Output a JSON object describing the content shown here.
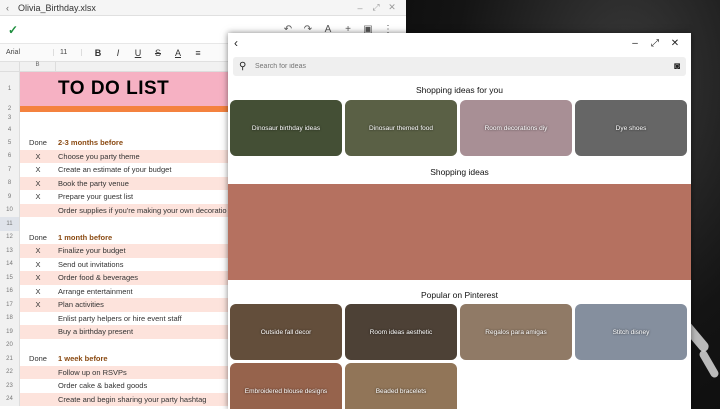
{
  "sheet": {
    "filename": "Olivia_Birthday.xlsx",
    "font": "Arial",
    "font_size": "11",
    "col_headers": [
      "B",
      "C"
    ],
    "rows": [
      {
        "n": "1",
        "a": "",
        "b": "TO DO LIST",
        "style": "title-row"
      },
      {
        "n": "2",
        "a": "",
        "b": "",
        "style": "orange"
      },
      {
        "n": "3",
        "a": "",
        "b": "",
        "style": "blank"
      },
      {
        "n": "4",
        "a": "",
        "b": "",
        "style": "blank"
      },
      {
        "n": "5",
        "a": "Done",
        "b": "2-3 months before",
        "style": "r hdr"
      },
      {
        "n": "6",
        "a": "X",
        "b": "Choose you party theme",
        "style": "r pink"
      },
      {
        "n": "7",
        "a": "X",
        "b": "Create an estimate of your budget",
        "style": "r"
      },
      {
        "n": "8",
        "a": "X",
        "b": "Book the party venue",
        "style": "r pink"
      },
      {
        "n": "9",
        "a": "X",
        "b": "Prepare your guest list",
        "style": "r"
      },
      {
        "n": "10",
        "a": "",
        "b": "Order supplies if you're making your own decoratio",
        "style": "r pink"
      },
      {
        "n": "11",
        "a": "",
        "b": "",
        "style": "r gray"
      },
      {
        "n": "12",
        "a": "Done",
        "b": "1 month before",
        "style": "r hdr"
      },
      {
        "n": "13",
        "a": "X",
        "b": "Finalize your budget",
        "style": "r pink"
      },
      {
        "n": "14",
        "a": "X",
        "b": "Send out invitations",
        "style": "r"
      },
      {
        "n": "15",
        "a": "X",
        "b": "Order food & beverages",
        "style": "r pink"
      },
      {
        "n": "16",
        "a": "X",
        "b": "Arrange entertainment",
        "style": "r"
      },
      {
        "n": "17",
        "a": "X",
        "b": "Plan activities",
        "style": "r pink"
      },
      {
        "n": "18",
        "a": "",
        "b": "Enlist party helpers or hire event staff",
        "style": "r"
      },
      {
        "n": "19",
        "a": "",
        "b": "Buy a birthday present",
        "style": "r pink"
      },
      {
        "n": "20",
        "a": "",
        "b": "",
        "style": "r"
      },
      {
        "n": "21",
        "a": "Done",
        "b": "1 week before",
        "style": "r hdr"
      },
      {
        "n": "22",
        "a": "",
        "b": "Follow up on RSVPs",
        "style": "r pink"
      },
      {
        "n": "23",
        "a": "",
        "b": "Order cake & baked goods",
        "style": "r"
      },
      {
        "n": "24",
        "a": "",
        "b": "Create and begin sharing your party hashtag",
        "style": "r pink"
      }
    ]
  },
  "pinterest": {
    "search_placeholder": "Search for ideas",
    "shopping_ideas_for_you": "Shopping ideas for you",
    "shopping_ideas": "Shopping ideas",
    "popular": "Popular on Pinterest",
    "shopping_cards": [
      {
        "label": "Dinosaur birthday ideas",
        "color": "#5f6e4a"
      },
      {
        "label": "Dinosaur themed food",
        "color": "#7d8560"
      },
      {
        "label": "Room decorations diy",
        "color": "#e9c6cf"
      },
      {
        "label": "Dye shoes",
        "color": "#8e8e8e"
      }
    ],
    "popular_cards": [
      {
        "label": "Outside fall decor",
        "color": "#8a6d52"
      },
      {
        "label": "Room ideas aesthetic",
        "color": "#6b5a4c"
      },
      {
        "label": "Regalos para amigas",
        "color": "#c8a98e"
      },
      {
        "label": "Stitch disney",
        "color": "#b9c6dc"
      },
      {
        "label": "Embroidered blouse designs",
        "color": "#d08a6a"
      },
      {
        "label": "Beaded bracelets",
        "color": "#c9a27a"
      }
    ],
    "banner_color": "#b57160"
  }
}
